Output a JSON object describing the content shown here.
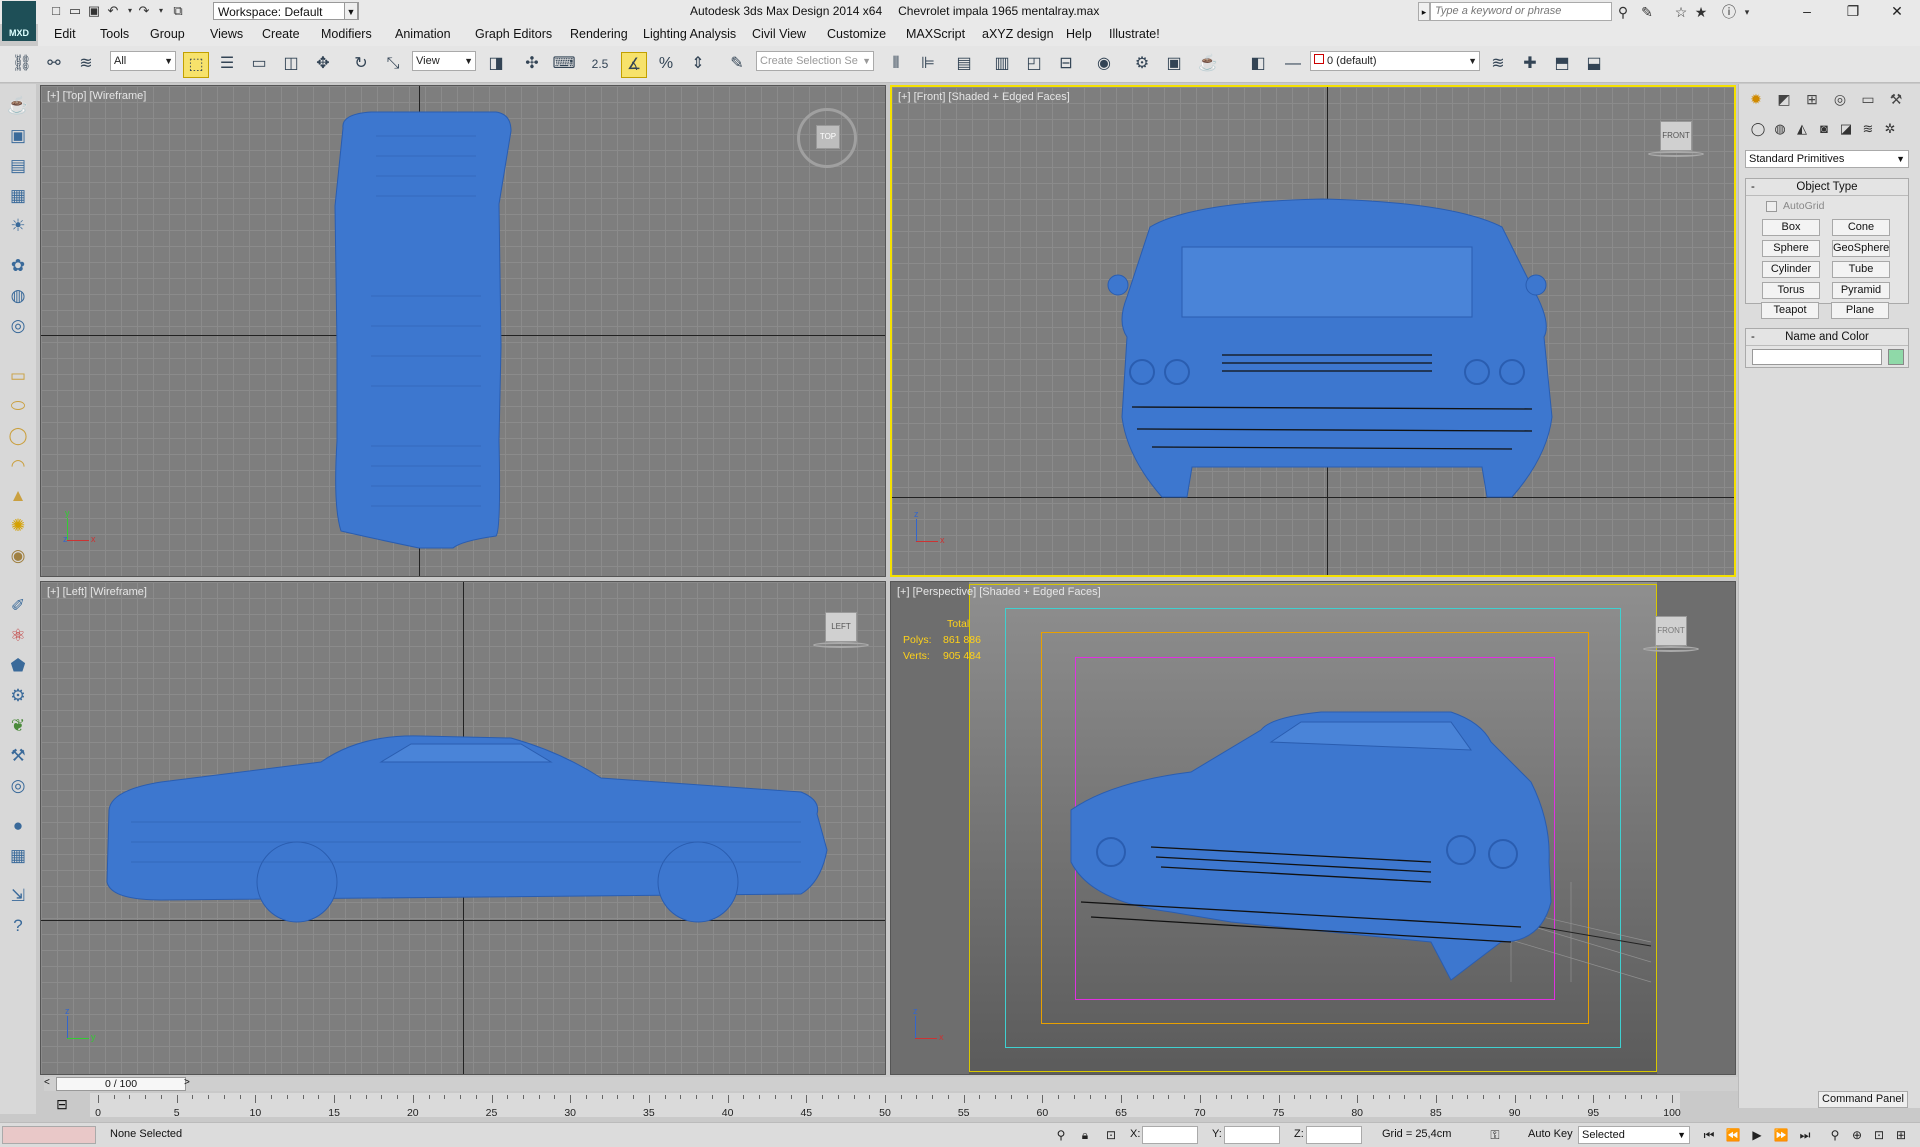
{
  "window": {
    "app_title": "Autodesk 3ds Max Design 2014 x64",
    "file_title": "Chevrolet impala 1965 mentalray.max",
    "logo_text": "MXD",
    "workspace_label": "Workspace: Default",
    "search_placeholder": "Type a keyword or phrase"
  },
  "menu": [
    "Edit",
    "Tools",
    "Group",
    "Views",
    "Create",
    "Modifiers",
    "Animation",
    "Graph Editors",
    "Rendering",
    "Lighting Analysis",
    "Civil View",
    "Customize",
    "MAXScript",
    "aXYZ design",
    "Help",
    "Illustrate!"
  ],
  "toolbar": {
    "selection_filter": "All",
    "ref_coord": "View",
    "snap_value": "2.5",
    "named_selection_placeholder": "Create Selection Se",
    "layer": "0 (default)"
  },
  "viewports": {
    "top": {
      "label": "[+] [Top] [Wireframe]",
      "navcube": "TOP"
    },
    "front": {
      "label": "[+] [Front] [Shaded + Edged Faces]",
      "navcube": "FRONT"
    },
    "left": {
      "label": "[+] [Left] [Wireframe]",
      "navcube": "LEFT"
    },
    "perspective": {
      "label": "[+] [Perspective] [Shaded + Edged Faces]",
      "navcube": "FRONT",
      "stats": {
        "header": "Total",
        "polys_label": "Polys:",
        "polys": "861 886",
        "verts_label": "Verts:",
        "verts": "905 484"
      }
    }
  },
  "command_panel": {
    "category": "Standard Primitives",
    "object_type_title": "Object Type",
    "autogrid": "AutoGrid",
    "buttons": [
      "Box",
      "Cone",
      "Sphere",
      "GeoSphere",
      "Cylinder",
      "Tube",
      "Torus",
      "Pyramid",
      "Teapot",
      "Plane"
    ],
    "name_color_title": "Name and Color",
    "name_value": "",
    "color": "#8fd9a8",
    "label": "Command Panel"
  },
  "timeline": {
    "frame_display": "0 / 100",
    "ticks": [
      "0",
      "5",
      "10",
      "15",
      "20",
      "25",
      "30",
      "35",
      "40",
      "45",
      "50",
      "55",
      "60",
      "65",
      "70",
      "75",
      "80",
      "85",
      "90",
      "95",
      "100"
    ]
  },
  "status": {
    "selection": "None Selected",
    "x_label": "X:",
    "y_label": "Y:",
    "z_label": "Z:",
    "grid": "Grid = 25,4cm",
    "auto_key": "Auto Key",
    "key_filter": "Selected"
  }
}
